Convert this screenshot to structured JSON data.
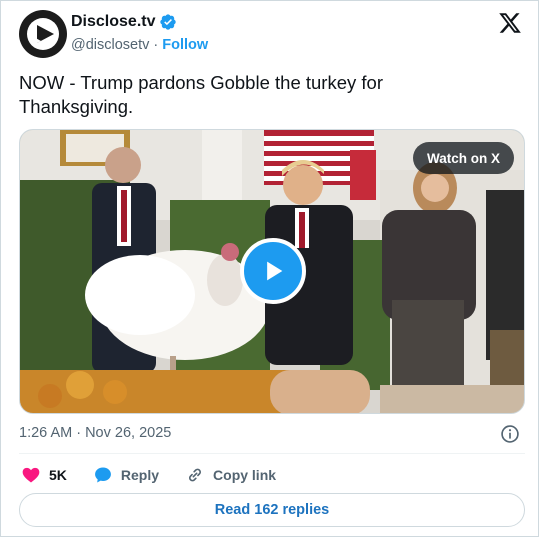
{
  "account": {
    "display_name": "Disclose.tv",
    "handle": "@disclosetv",
    "separator": "·",
    "follow_label": "Follow"
  },
  "tweet": {
    "text": "NOW - Trump pardons Gobble the turkey for Thanksgiving.",
    "timestamp": "1:26 AM · Nov 26, 2025"
  },
  "media": {
    "watch_label": "Watch on X"
  },
  "actions": {
    "like_count": "5K",
    "reply_label": "Reply",
    "copy_link_label": "Copy link"
  },
  "read_replies_label": "Read 162 replies",
  "colors": {
    "accent": "#1d9bf0",
    "like": "#f91880",
    "text": "#0f1419",
    "muted": "#536471"
  }
}
